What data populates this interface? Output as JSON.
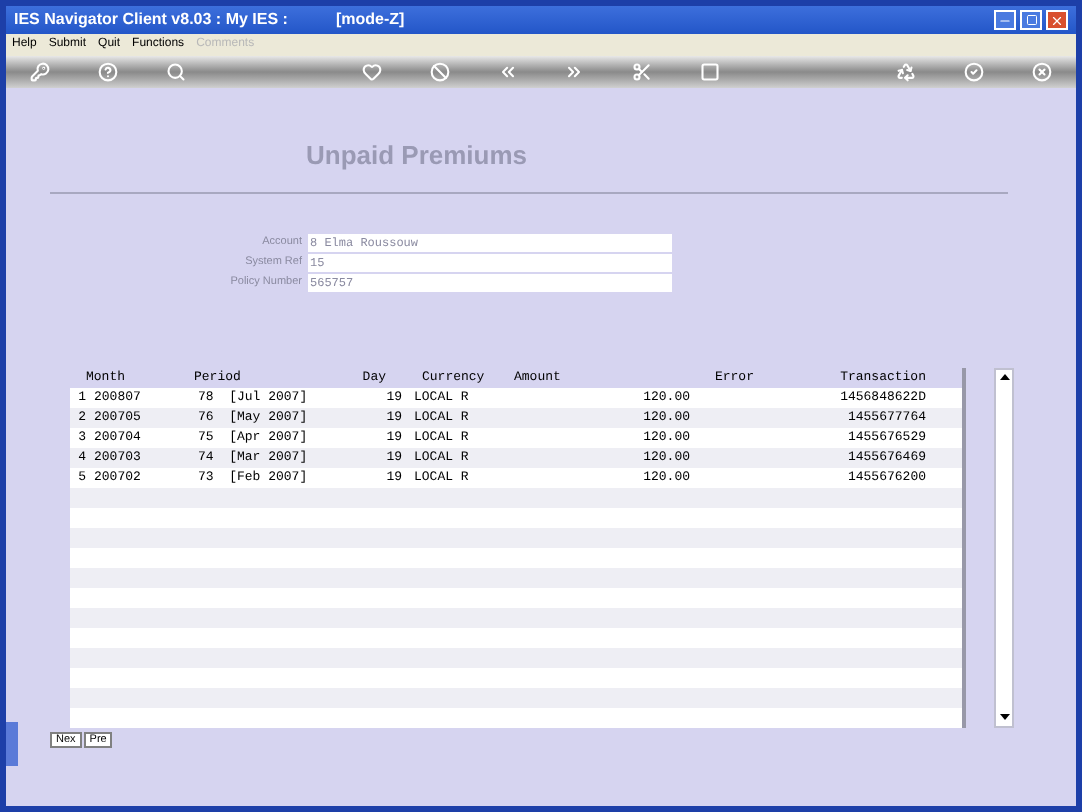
{
  "window": {
    "title": "IES Navigator Client v8.03 : My IES :",
    "mode": "[mode-Z]"
  },
  "menu": [
    {
      "label": "Help",
      "disabled": false
    },
    {
      "label": "Submit",
      "disabled": false
    },
    {
      "label": "Quit",
      "disabled": false
    },
    {
      "label": "Functions",
      "disabled": false
    },
    {
      "label": "Comments",
      "disabled": true
    }
  ],
  "heading": "Unpaid Premiums",
  "fields": [
    {
      "label": "Account",
      "value": "8 Elma Roussouw"
    },
    {
      "label": "System Ref",
      "value": "15"
    },
    {
      "label": "Policy Number",
      "value": "565757"
    }
  ],
  "table": {
    "columns": [
      "Month",
      "Period",
      "Day",
      "Currency",
      "Amount",
      "Error",
      "Transaction"
    ],
    "rows": [
      {
        "index": "1",
        "month": "200807",
        "period": "78  [Jul 2007]",
        "day": "19",
        "currency": "LOCAL R",
        "amount": "120.00",
        "transaction": "1456848622D"
      },
      {
        "index": "2",
        "month": "200705",
        "period": "76  [May 2007]",
        "day": "19",
        "currency": "LOCAL R",
        "amount": "120.00",
        "transaction": "1455677764"
      },
      {
        "index": "3",
        "month": "200704",
        "period": "75  [Apr 2007]",
        "day": "19",
        "currency": "LOCAL R",
        "amount": "120.00",
        "transaction": "1455676529"
      },
      {
        "index": "4",
        "month": "200703",
        "period": "74  [Mar 2007]",
        "day": "19",
        "currency": "LOCAL R",
        "amount": "120.00",
        "transaction": "1455676469"
      },
      {
        "index": "5",
        "month": "200702",
        "period": "73  [Feb 2007]",
        "day": "19",
        "currency": "LOCAL R",
        "amount": "120.00",
        "transaction": "1455676200"
      }
    ]
  },
  "bottom_tabs": [
    {
      "label": "Nex",
      "selected": false
    },
    {
      "label": "Pre",
      "selected": false
    }
  ]
}
